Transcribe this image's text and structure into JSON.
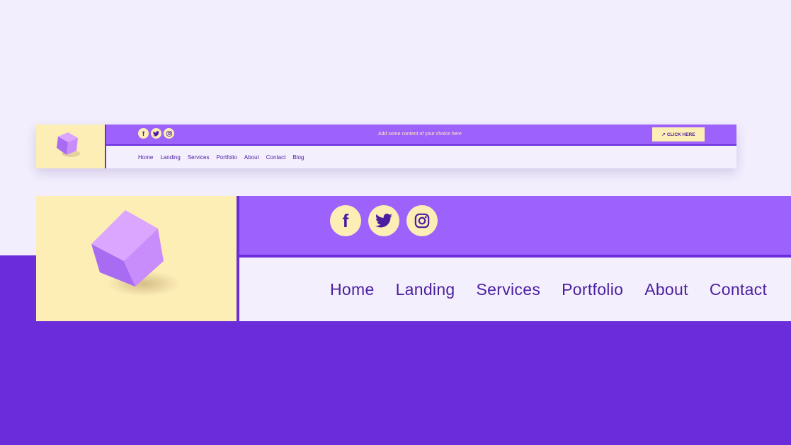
{
  "colors": {
    "background": "#f2eefd",
    "accent_dark": "#6b2cd9",
    "accent": "#9d62fb",
    "cream": "#fdeeb6",
    "nav_text": "#4b1ea0",
    "cube_light": "#dba6ff",
    "cube_mid": "#c98cfb",
    "cube_dark": "#a86cf2"
  },
  "logo": {
    "icon": "cube-icon"
  },
  "small_header": {
    "social": [
      {
        "icon": "facebook-icon",
        "glyph": "f"
      },
      {
        "icon": "twitter-icon"
      },
      {
        "icon": "instagram-icon"
      }
    ],
    "topbar_text": "Add some content of your choice here",
    "cta": {
      "arrow": "↗",
      "label": "CLICK HERE"
    },
    "nav": [
      "Home",
      "Landing",
      "Services",
      "Portfolio",
      "About",
      "Contact",
      "Blog"
    ]
  },
  "large_header": {
    "social": [
      {
        "icon": "facebook-icon",
        "glyph": "f"
      },
      {
        "icon": "twitter-icon"
      },
      {
        "icon": "instagram-icon"
      }
    ],
    "nav": [
      "Home",
      "Landing",
      "Services",
      "Portfolio",
      "About",
      "Contact"
    ]
  }
}
